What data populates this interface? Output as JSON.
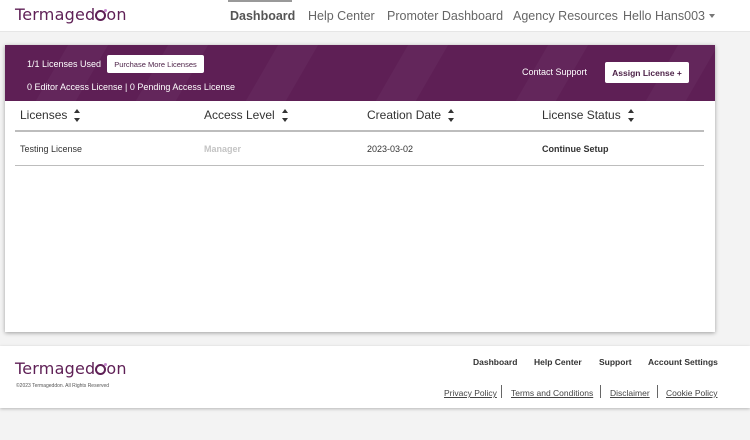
{
  "brand": {
    "logo_text_pre": "Termaged",
    "logo_text_post": "on",
    "accent": "#5e1f55"
  },
  "nav": {
    "items": [
      {
        "label": "Dashboard",
        "active": true
      },
      {
        "label": "Help Center"
      },
      {
        "label": "Promoter Dashboard"
      },
      {
        "label": "Agency Resources"
      }
    ],
    "user_label": "Hello Hans003"
  },
  "licenses_banner": {
    "used": "1/1 Licenses Used",
    "purchase_button": "Purchase More Licenses",
    "access_summary": "0 Editor Access License | 0 Pending Access License",
    "contact_link": "Contact Support",
    "assign_button": "Assign License +"
  },
  "table": {
    "columns": [
      "Licenses",
      "Access Level",
      "Creation Date",
      "License Status"
    ],
    "rows": [
      {
        "license": "Testing License",
        "access": "Manager",
        "date": "2023-03-02",
        "status": "Continue Setup"
      }
    ]
  },
  "footer": {
    "copyright": "©2023 Termageddon. All Rights Reserved",
    "links": [
      "Dashboard",
      "Help Center",
      "Support",
      "Account Settings"
    ],
    "legal": [
      "Privacy Policy",
      "Terms and Conditions",
      "Disclaimer",
      "Cookie Policy"
    ]
  }
}
